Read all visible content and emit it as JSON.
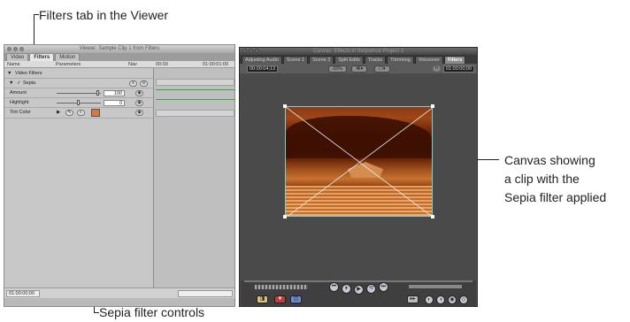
{
  "callouts": {
    "top": "Filters tab in the Viewer",
    "right_line1": "Canvas showing",
    "right_line2": "a clip with the",
    "right_line3": "Sepia filter applied",
    "bottom": "Sepia filter controls"
  },
  "viewer": {
    "title": "Viewer: Sample Clip 1 from Filters",
    "tabs": [
      "Video",
      "Filters",
      "Motion"
    ],
    "active_tab": "Filters",
    "columns": {
      "name": "Name",
      "parameters": "Parameters",
      "nav": "Nav",
      "time_start": "00:00",
      "time_end": "01:00:01:00"
    },
    "group": "Video Filters",
    "filter": "Sepia",
    "params": [
      {
        "label": "Amount",
        "value": "100"
      },
      {
        "label": "Highlight",
        "value": "0"
      },
      {
        "label": "Tint Color",
        "value": ""
      }
    ],
    "tint_color": "#d9763f",
    "timecode": "01:00:00;00"
  },
  "canvas": {
    "title": "Canvas: Effects in Sequence Project 1",
    "tabs": [
      "Adjusting Audio",
      "Scene 1",
      "Scene 2",
      "Split Edits",
      "Tracks",
      "Trimming",
      "Voiceover",
      "Filters"
    ],
    "active_tab": "Filters",
    "timecode_left": "00:00:04;13",
    "zoom": "33%",
    "timecode_right": "01:00:00;00"
  }
}
